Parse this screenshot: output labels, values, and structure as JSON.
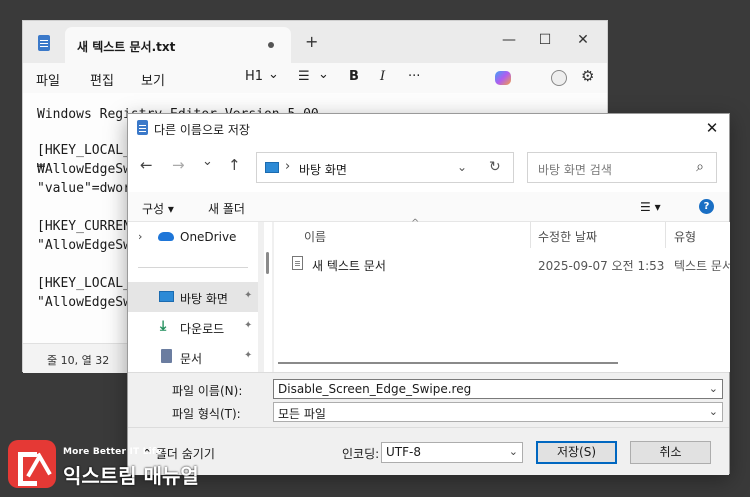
{
  "notepad": {
    "tab_title": "새 텍스트 문서.txt",
    "new_tab": "+",
    "window_controls": {
      "minimize": "—",
      "maximize": "☐",
      "close": "✕"
    },
    "menus": [
      "파일",
      "편집",
      "보기"
    ],
    "tools": {
      "heading": "H1",
      "heading_caret": "⌄",
      "list": "☰",
      "list_caret": "⌄",
      "bold": "B",
      "italic": "I",
      "more": "···"
    },
    "lines": [
      "Windows Registry Editor Version 5.00",
      "[HKEY_LOCAL_",
      "₩AllowEdgeSw",
      "\"value\"=dword",
      "[HKEY_CURREN",
      "\"AllowEdgeSw",
      "[HKEY_LOCAL_",
      "\"AllowEdgeSw"
    ],
    "status": "줄 10, 열 32"
  },
  "dialog": {
    "title": "다른 이름으로 저장",
    "close": "✕",
    "nav": {
      "back": "←",
      "forward": "→",
      "recent": "⌄",
      "up": "↑"
    },
    "address": {
      "separator": "›",
      "location": "바탕 화면",
      "dropdown": "⌄",
      "refresh": "↻"
    },
    "search_placeholder": "바탕 화면 검색",
    "search_icon": "⌕",
    "commands": {
      "organize": "구성 ▾",
      "new_folder": "새 폴더",
      "view": "☰ ▾",
      "help": "?"
    },
    "nav_pane": [
      {
        "label": "OneDrive",
        "icon": "cloud-icon",
        "chevron": "›"
      },
      {
        "label": "바탕 화면",
        "icon": "desktop-icon",
        "pinned": true,
        "selected": true
      },
      {
        "label": "다운로드",
        "icon": "download-icon",
        "pinned": true
      },
      {
        "label": "문서",
        "icon": "document-icon",
        "pinned": true
      }
    ],
    "pin_glyph": "📌",
    "columns": [
      "이름",
      "수정한 날짜",
      "유형"
    ],
    "sort_caret": "^",
    "files": [
      {
        "name": "새 텍스트 문서",
        "modified": "2025-09-07 오전 1:53",
        "type": "텍스트 문서"
      }
    ],
    "filename_label": "파일 이름(N):",
    "filename_value": "Disable_Screen_Edge_Swipe.reg",
    "filetype_label": "파일 형식(T):",
    "filetype_value": "모든 파일",
    "dropdown_caret": "⌄",
    "hide_folders": "^ 폴더 숨기기",
    "encoding_label": "인코딩:",
    "encoding_value": "UTF-8",
    "save_button": "저장(S)",
    "cancel_button": "취소"
  },
  "logo": {
    "subtitle": "More Better IT Life",
    "name": "익스트림 매뉴얼"
  }
}
